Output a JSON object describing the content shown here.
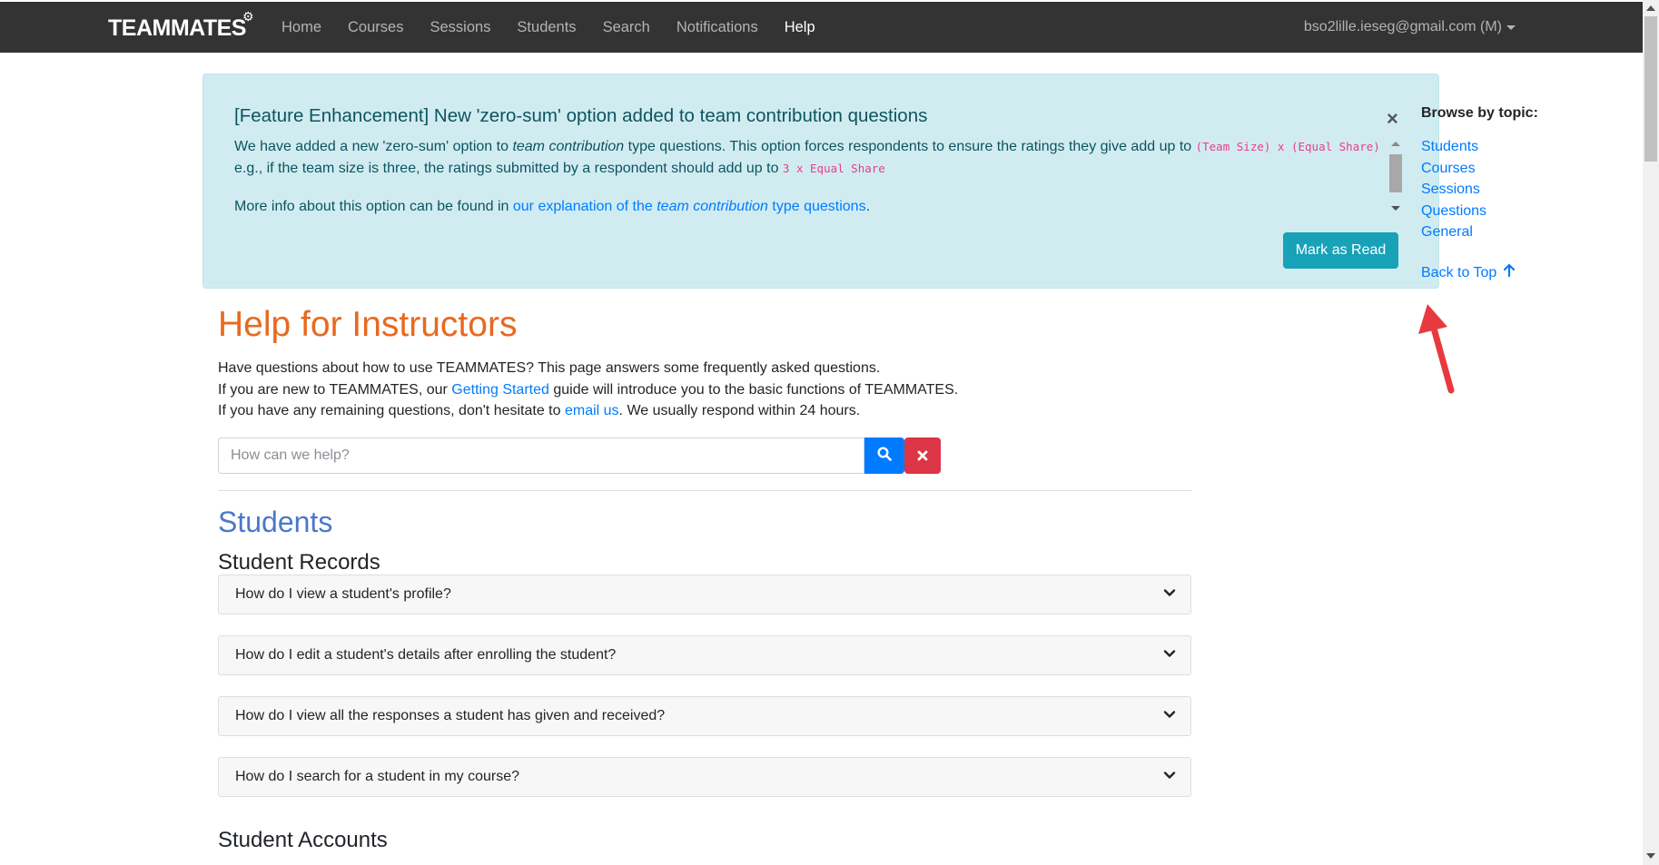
{
  "navbar": {
    "brand": "TEAMMATES",
    "items": [
      "Home",
      "Courses",
      "Sessions",
      "Students",
      "Search",
      "Notifications",
      "Help"
    ],
    "active_item": "Help",
    "user": "bso2lille.ieseg@gmail.com (M)"
  },
  "notice": {
    "title": "[Feature Enhancement] New 'zero-sum' option added to team contribution questions",
    "line1_pre": "We have added a new 'zero-sum' option to ",
    "line1_em": "team contribution",
    "line1_post": " type questions. This option forces respondents to ensure the ratings they give add up to ",
    "line1_code": "(Team Size) x (Equal Share)",
    "line2_pre": "e.g., if the team size is three, the ratings submitted by a respondent should add up to ",
    "line2_code": "3 x Equal Share",
    "line3_pre": "More info about this option can be found in ",
    "line3_link_pre": "our explanation of the ",
    "line3_link_em": "team contribution",
    "line3_link_post": " type questions",
    "line3_end": ".",
    "close_label": "×",
    "mark_read_label": "Mark as Read"
  },
  "topics": {
    "heading": "Browse by topic:",
    "items": [
      "Students",
      "Courses",
      "Sessions",
      "Questions",
      "General"
    ],
    "back_to_top": "Back to Top"
  },
  "main": {
    "title": "Help for Instructors",
    "intro1": "Have questions about how to use TEAMMATES? This page answers some frequently asked questions.",
    "intro2_pre": "If you are new to TEAMMATES, our ",
    "intro2_link": "Getting Started",
    "intro2_post": " guide will introduce you to the basic functions of TEAMMATES.",
    "intro3_pre": "If you have any remaining questions, don't hesitate to ",
    "intro3_link": "email us",
    "intro3_post": ". We usually respond within 24 hours.",
    "search_placeholder": "How can we help?",
    "section": "Students",
    "subsection1": "Student Records",
    "questions": [
      "How do I view a student's profile?",
      "How do I edit a student's details after enrolling the student?",
      "How do I view all the responses a student has given and received?",
      "How do I search for a student in my course?"
    ],
    "subsection2": "Student Accounts"
  },
  "colors": {
    "navbar_bg": "#333333",
    "notice_bg": "#d1ecf1",
    "title_orange": "#e8691f",
    "section_blue": "#4a79c7",
    "link_blue": "#007bff",
    "mark_read_bg": "#17a2b8",
    "clear_red": "#dc3545"
  },
  "icons": [
    "gear-icon",
    "caret-down-icon",
    "close-icon",
    "search-icon",
    "times-icon",
    "arrow-up-icon",
    "chevron-down-icon"
  ]
}
